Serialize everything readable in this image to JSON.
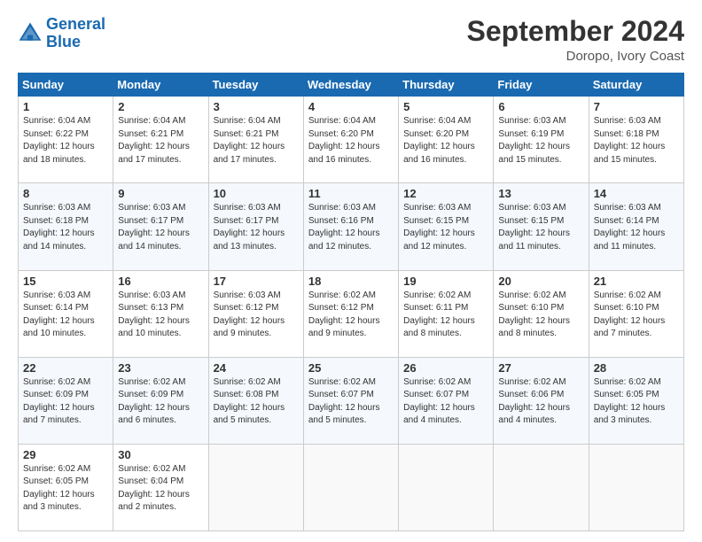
{
  "logo": {
    "line1": "General",
    "line2": "Blue"
  },
  "title": "September 2024",
  "location": "Doropo, Ivory Coast",
  "days_of_week": [
    "Sunday",
    "Monday",
    "Tuesday",
    "Wednesday",
    "Thursday",
    "Friday",
    "Saturday"
  ],
  "weeks": [
    [
      {
        "day": "1",
        "info": "Sunrise: 6:04 AM\nSunset: 6:22 PM\nDaylight: 12 hours\nand 18 minutes."
      },
      {
        "day": "2",
        "info": "Sunrise: 6:04 AM\nSunset: 6:21 PM\nDaylight: 12 hours\nand 17 minutes."
      },
      {
        "day": "3",
        "info": "Sunrise: 6:04 AM\nSunset: 6:21 PM\nDaylight: 12 hours\nand 17 minutes."
      },
      {
        "day": "4",
        "info": "Sunrise: 6:04 AM\nSunset: 6:20 PM\nDaylight: 12 hours\nand 16 minutes."
      },
      {
        "day": "5",
        "info": "Sunrise: 6:04 AM\nSunset: 6:20 PM\nDaylight: 12 hours\nand 16 minutes."
      },
      {
        "day": "6",
        "info": "Sunrise: 6:03 AM\nSunset: 6:19 PM\nDaylight: 12 hours\nand 15 minutes."
      },
      {
        "day": "7",
        "info": "Sunrise: 6:03 AM\nSunset: 6:18 PM\nDaylight: 12 hours\nand 15 minutes."
      }
    ],
    [
      {
        "day": "8",
        "info": "Sunrise: 6:03 AM\nSunset: 6:18 PM\nDaylight: 12 hours\nand 14 minutes."
      },
      {
        "day": "9",
        "info": "Sunrise: 6:03 AM\nSunset: 6:17 PM\nDaylight: 12 hours\nand 14 minutes."
      },
      {
        "day": "10",
        "info": "Sunrise: 6:03 AM\nSunset: 6:17 PM\nDaylight: 12 hours\nand 13 minutes."
      },
      {
        "day": "11",
        "info": "Sunrise: 6:03 AM\nSunset: 6:16 PM\nDaylight: 12 hours\nand 12 minutes."
      },
      {
        "day": "12",
        "info": "Sunrise: 6:03 AM\nSunset: 6:15 PM\nDaylight: 12 hours\nand 12 minutes."
      },
      {
        "day": "13",
        "info": "Sunrise: 6:03 AM\nSunset: 6:15 PM\nDaylight: 12 hours\nand 11 minutes."
      },
      {
        "day": "14",
        "info": "Sunrise: 6:03 AM\nSunset: 6:14 PM\nDaylight: 12 hours\nand 11 minutes."
      }
    ],
    [
      {
        "day": "15",
        "info": "Sunrise: 6:03 AM\nSunset: 6:14 PM\nDaylight: 12 hours\nand 10 minutes."
      },
      {
        "day": "16",
        "info": "Sunrise: 6:03 AM\nSunset: 6:13 PM\nDaylight: 12 hours\nand 10 minutes."
      },
      {
        "day": "17",
        "info": "Sunrise: 6:03 AM\nSunset: 6:12 PM\nDaylight: 12 hours\nand 9 minutes."
      },
      {
        "day": "18",
        "info": "Sunrise: 6:02 AM\nSunset: 6:12 PM\nDaylight: 12 hours\nand 9 minutes."
      },
      {
        "day": "19",
        "info": "Sunrise: 6:02 AM\nSunset: 6:11 PM\nDaylight: 12 hours\nand 8 minutes."
      },
      {
        "day": "20",
        "info": "Sunrise: 6:02 AM\nSunset: 6:10 PM\nDaylight: 12 hours\nand 8 minutes."
      },
      {
        "day": "21",
        "info": "Sunrise: 6:02 AM\nSunset: 6:10 PM\nDaylight: 12 hours\nand 7 minutes."
      }
    ],
    [
      {
        "day": "22",
        "info": "Sunrise: 6:02 AM\nSunset: 6:09 PM\nDaylight: 12 hours\nand 7 minutes."
      },
      {
        "day": "23",
        "info": "Sunrise: 6:02 AM\nSunset: 6:09 PM\nDaylight: 12 hours\nand 6 minutes."
      },
      {
        "day": "24",
        "info": "Sunrise: 6:02 AM\nSunset: 6:08 PM\nDaylight: 12 hours\nand 5 minutes."
      },
      {
        "day": "25",
        "info": "Sunrise: 6:02 AM\nSunset: 6:07 PM\nDaylight: 12 hours\nand 5 minutes."
      },
      {
        "day": "26",
        "info": "Sunrise: 6:02 AM\nSunset: 6:07 PM\nDaylight: 12 hours\nand 4 minutes."
      },
      {
        "day": "27",
        "info": "Sunrise: 6:02 AM\nSunset: 6:06 PM\nDaylight: 12 hours\nand 4 minutes."
      },
      {
        "day": "28",
        "info": "Sunrise: 6:02 AM\nSunset: 6:05 PM\nDaylight: 12 hours\nand 3 minutes."
      }
    ],
    [
      {
        "day": "29",
        "info": "Sunrise: 6:02 AM\nSunset: 6:05 PM\nDaylight: 12 hours\nand 3 minutes."
      },
      {
        "day": "30",
        "info": "Sunrise: 6:02 AM\nSunset: 6:04 PM\nDaylight: 12 hours\nand 2 minutes."
      },
      {
        "day": "",
        "info": ""
      },
      {
        "day": "",
        "info": ""
      },
      {
        "day": "",
        "info": ""
      },
      {
        "day": "",
        "info": ""
      },
      {
        "day": "",
        "info": ""
      }
    ]
  ]
}
